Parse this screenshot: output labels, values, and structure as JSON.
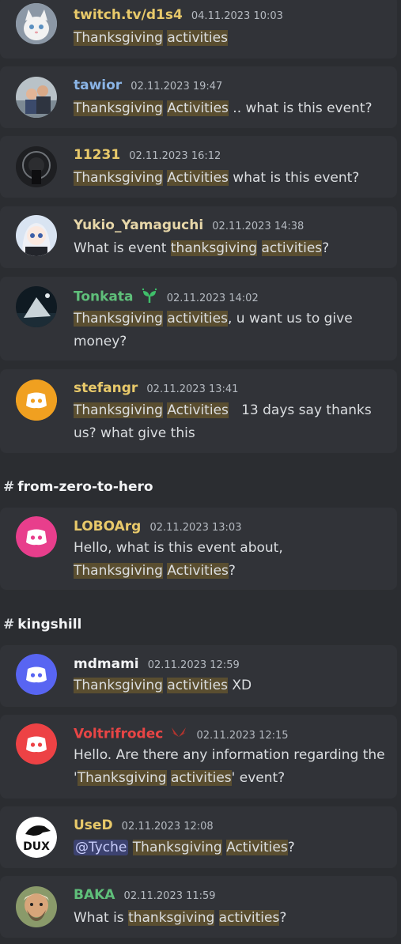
{
  "colors": {
    "background": "#2b2d31",
    "card": "#313338",
    "highlight": "#5a4e30",
    "mention_bg": "#3c4270"
  },
  "messages": [
    {
      "username": "twitch.tv/d1s4",
      "name_color": "#e8c96a",
      "timestamp": "04.11.2023 10:03",
      "avatar": "white-cat-avatar",
      "parts": [
        "",
        "Thanksgiving",
        " ",
        "activities",
        ""
      ]
    },
    {
      "username": "tawior",
      "name_color": "#8ab4e6",
      "timestamp": "02.11.2023 19:47",
      "avatar": "family-photo-avatar",
      "parts": [
        "",
        "Thanksgiving",
        " ",
        "Activities",
        " .. what is this event?"
      ]
    },
    {
      "username": "11231",
      "name_color": "#e8c96a",
      "timestamp": "02.11.2023 16:12",
      "avatar": "dark-logo-avatar",
      "parts": [
        "",
        "Thanksgiving",
        " ",
        "Activities",
        " what is this event?"
      ]
    },
    {
      "username": "Yukio_Yamaguchi",
      "name_color": "#e6d6a8",
      "timestamp": "02.11.2023 14:38",
      "avatar": "anime-girl-avatar",
      "parts": [
        "What is event ",
        "thanksgiving",
        " ",
        "activities",
        "?"
      ]
    },
    {
      "username": "Tonkata",
      "name_color": "#5fbf7a",
      "timestamp": "02.11.2023 14:02",
      "avatar": "night-scene-avatar",
      "badge": "sprout-icon",
      "parts": [
        "",
        "Thanksgiving",
        " ",
        "activities",
        ", u want us to give money?"
      ]
    },
    {
      "username": "stefangr",
      "name_color": "#e8c96a",
      "timestamp": "02.11.2023 13:41",
      "avatar": "discord-logo-orange-avatar",
      "parts": [
        "",
        "Thanksgiving",
        " ",
        "Activities",
        "   13 days say thanks us? what give this"
      ]
    },
    {
      "username": "LOBOArg",
      "name_color": "#e8c96a",
      "timestamp": "02.11.2023 13:03",
      "avatar": "discord-logo-pink-avatar",
      "parts": [
        "Hello, what is this event about, ",
        "Thanksgiving",
        " ",
        "Activities",
        "?"
      ]
    },
    {
      "username": "mdmami",
      "name_color": "#f2f3f5",
      "timestamp": "02.11.2023 12:59",
      "avatar": "discord-logo-blurple-avatar",
      "parts": [
        "",
        "Thanksgiving",
        " ",
        "activities",
        " XD"
      ]
    },
    {
      "username": "Voltrifrodec",
      "name_color": "#e84545",
      "timestamp": "02.11.2023 12:15",
      "avatar": "discord-logo-red-avatar",
      "badge": "wings-icon",
      "parts": [
        "Hello. Are there any information regarding the '",
        "Thanksgiving",
        " ",
        "activities",
        "' event?"
      ]
    },
    {
      "username": "UseD",
      "name_color": "#e8c96a",
      "timestamp": "02.11.2023 12:08",
      "avatar": "dux-logo-avatar",
      "mention": "@Tyche",
      "parts": [
        " ",
        "Thanksgiving",
        " ",
        "Activities",
        "?"
      ]
    },
    {
      "username": "BAKA",
      "name_color": "#5fbf7a",
      "timestamp": "02.11.2023 11:59",
      "avatar": "bearded-man-avatar",
      "parts": [
        "What is ",
        "thanksgiving",
        " ",
        "activities",
        "?"
      ]
    }
  ],
  "channels": [
    {
      "hash": "#",
      "name": "from-zero-to-hero"
    },
    {
      "hash": "#",
      "name": "kingshill"
    }
  ]
}
